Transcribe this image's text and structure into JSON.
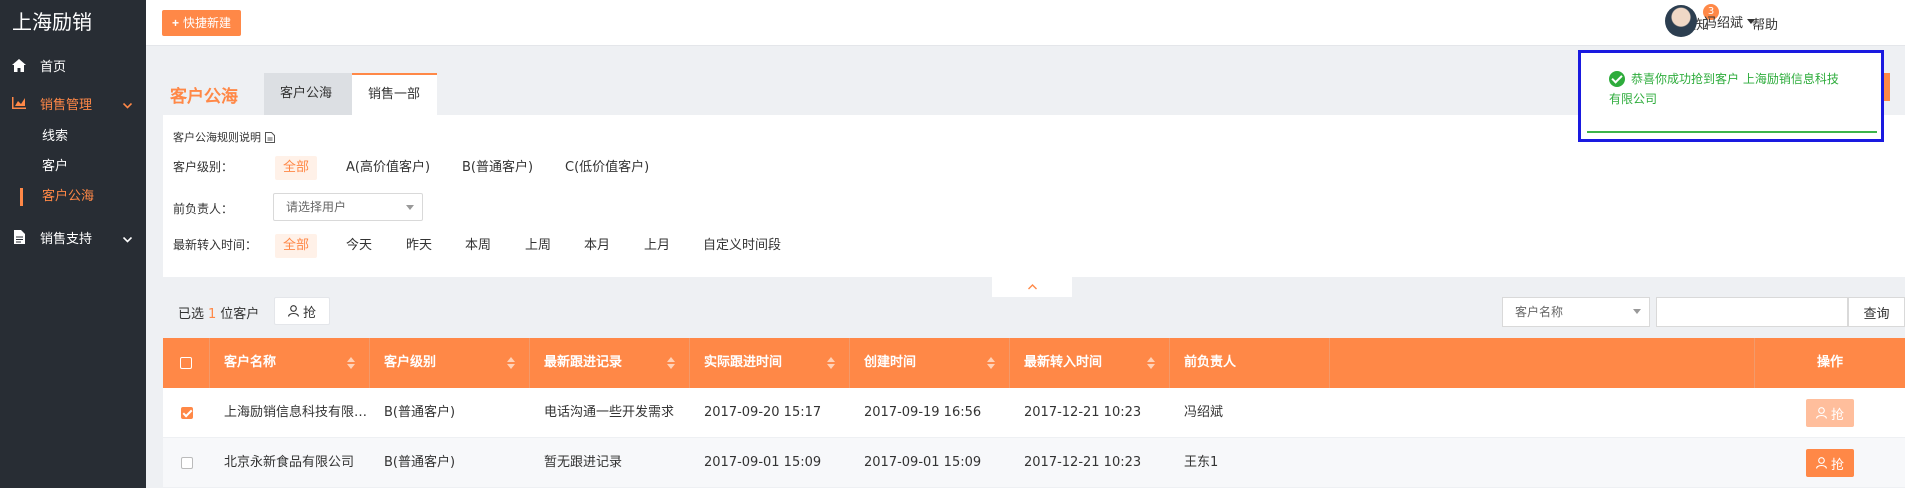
{
  "brand": "上海励销",
  "nav": {
    "home": "首页",
    "sales_mgmt": "销售管理",
    "sub": [
      "线索",
      "客户",
      "客户公海"
    ],
    "sales_support": "销售支持"
  },
  "topbar": {
    "quick_new": "快捷新建",
    "notice": "通知",
    "notice_count": "3",
    "help": "帮助",
    "user": "冯绍斌"
  },
  "page": {
    "title": "客户公海",
    "tabs": [
      "客户公海",
      "销售一部"
    ]
  },
  "filters": {
    "rule": "客户公海规则说明",
    "level_label": "客户级别：",
    "level_options": [
      "全部",
      "A(高价值客户)",
      "B(普通客户)",
      "C(低价值客户)"
    ],
    "owner_label": "前负责人：",
    "owner_placeholder": "请选择用户",
    "time_label": "最新转入时间：",
    "time_options": [
      "全部",
      "今天",
      "昨天",
      "本周",
      "上周",
      "本月",
      "上月",
      "自定义时间段"
    ]
  },
  "selection": {
    "prefix": "已选",
    "count": "1",
    "suffix": "位客户",
    "grab": "抢"
  },
  "search": {
    "type": "客户名称",
    "button": "查询"
  },
  "table": {
    "headers": [
      "客户名称",
      "客户级别",
      "最新跟进记录",
      "实际跟进时间",
      "创建时间",
      "最新转入时间",
      "前负责人",
      "操作"
    ],
    "rows": [
      {
        "checked": true,
        "name": "上海励销信息科技有限公司",
        "level": "B(普通客户)",
        "record": "电话沟通一些开发需求",
        "followed": "2017-09-20 15:17",
        "created": "2017-09-19 16:56",
        "transferred": "2017-12-21 10:23",
        "owner": "冯绍斌",
        "action": "抢"
      },
      {
        "checked": false,
        "name": "北京永新食品有限公司",
        "level": "B(普通客户)",
        "record": "暂无跟进记录",
        "followed": "2017-09-01 15:09",
        "created": "2017-09-01 15:09",
        "transferred": "2017-12-21 10:23",
        "owner": "王东1",
        "action": "抢"
      }
    ]
  },
  "toast": {
    "message": "恭喜你成功抢到客户 上海励销信息科技有限公司"
  },
  "colors": {
    "accent": "#ff8847",
    "sidebar": "#282d34",
    "success": "#2eac3c",
    "highlight_border": "#1a1ae0"
  }
}
